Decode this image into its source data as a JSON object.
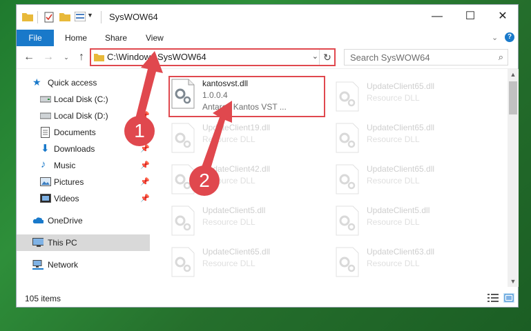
{
  "window": {
    "title": "SysWOW64",
    "controls": {
      "minimize": "—",
      "maximize": "☐",
      "close": "✕"
    }
  },
  "ribbon": {
    "file": "File",
    "tabs": [
      "Home",
      "Share",
      "View"
    ],
    "expand_icon": "chevron-down-icon",
    "help_icon": "help-icon"
  },
  "address": {
    "path": "C:\\Windows\\SysWOW64",
    "search_placeholder": "Search SysWOW64"
  },
  "navigation": {
    "quick_access": "Quick access",
    "items": [
      {
        "label": "Local Disk (C:)",
        "icon": "drive-icon",
        "pinned": true
      },
      {
        "label": "Local Disk (D:)",
        "icon": "drive-icon",
        "pinned": true
      },
      {
        "label": "Documents",
        "icon": "documents-icon",
        "pinned": true
      },
      {
        "label": "Downloads",
        "icon": "downloads-icon",
        "pinned": true
      },
      {
        "label": "Music",
        "icon": "music-icon",
        "pinned": true
      },
      {
        "label": "Pictures",
        "icon": "pictures-icon",
        "pinned": true
      },
      {
        "label": "Videos",
        "icon": "videos-icon",
        "pinned": true
      }
    ],
    "onedrive": "OneDrive",
    "this_pc": "This PC",
    "network": "Network"
  },
  "files": {
    "highlighted": {
      "name": "kantosvst.dll",
      "version": "1.0.0.4",
      "description": "Antares Kantos VST ..."
    },
    "background": [
      {
        "name": "UpdateClient65.dll",
        "type": "Resource DLL"
      },
      {
        "name": "UpdateClient19.dll",
        "type": "Resource DLL"
      },
      {
        "name": "UpdateClient65.dll",
        "type": "Resource DLL"
      },
      {
        "name": "UpdateClient42.dll",
        "type": "Resource DLL"
      },
      {
        "name": "UpdateClient65.dll",
        "type": "Resource DLL"
      },
      {
        "name": "UpdateClient5.dll",
        "type": "Resource DLL"
      },
      {
        "name": "UpdateClient5.dll",
        "type": "Resource DLL"
      },
      {
        "name": "UpdateClient65.dll",
        "type": "Resource DLL"
      },
      {
        "name": "UpdateClient63.dll",
        "type": "Resource DLL"
      }
    ]
  },
  "status": {
    "item_count": "105 items"
  },
  "annotations": {
    "step1": "1",
    "step2": "2"
  },
  "colors": {
    "accent": "#1979ca",
    "highlight_red": "#e0484e",
    "background_green": "#2e8f3a"
  }
}
